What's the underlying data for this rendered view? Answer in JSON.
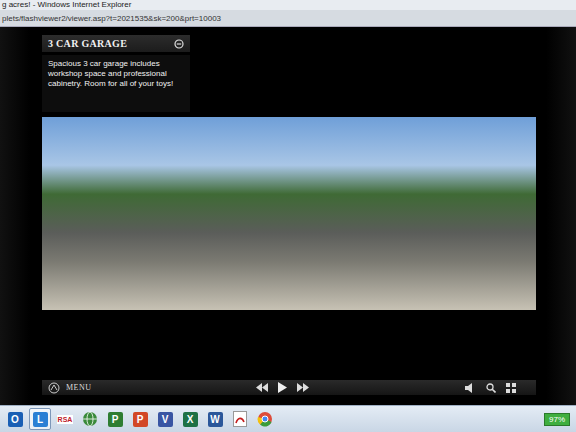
{
  "browser": {
    "title": "g acres! - Windows Internet Explorer",
    "address": "plets/flashviewer2/viewer.asp?t=2021535&sk=200&prt=10003"
  },
  "viewer": {
    "section_title": "3 CAR GARAGE",
    "description": "Spacious 3 car garage includes workshop space and professional cabinetry. Room for all of your toys!",
    "menu_label": "MENU"
  },
  "taskbar": {
    "apps": [
      {
        "label": "O",
        "kind": "letter",
        "color": "#1a5fb4",
        "selected": false
      },
      {
        "label": "L",
        "kind": "letter",
        "color": "#2a7fd4",
        "selected": true
      },
      {
        "label": "RSA",
        "kind": "text",
        "color": "#c0202a",
        "selected": false
      },
      {
        "label": "",
        "kind": "globe",
        "color": "#3a8a3a",
        "selected": false
      },
      {
        "label": "P",
        "kind": "letter",
        "color": "#2e7d32",
        "selected": false
      },
      {
        "label": "P",
        "kind": "letter",
        "color": "#d24726",
        "selected": false
      },
      {
        "label": "V",
        "kind": "letter",
        "color": "#3955a3",
        "selected": false
      },
      {
        "label": "X",
        "kind": "letter",
        "color": "#1e7145",
        "selected": false
      },
      {
        "label": "W",
        "kind": "letter",
        "color": "#2b579a",
        "selected": false
      },
      {
        "label": "",
        "kind": "pdf",
        "color": "#c41e1e",
        "selected": false
      },
      {
        "label": "",
        "kind": "chrome",
        "color": "#dd4b39",
        "selected": false
      }
    ],
    "battery": "97%"
  }
}
